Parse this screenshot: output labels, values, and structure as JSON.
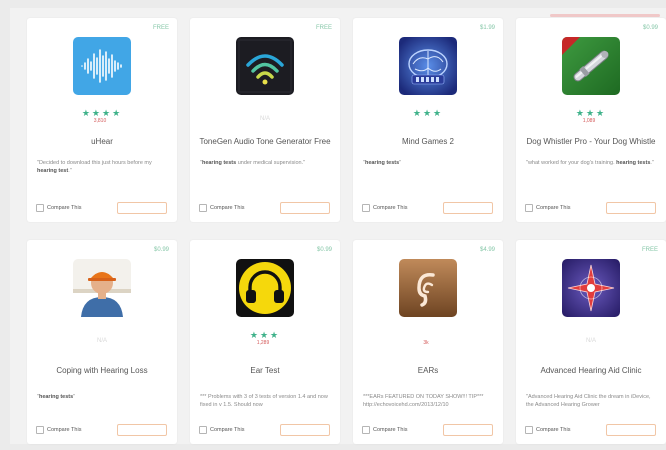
{
  "accent": {
    "price": "#86c7a8",
    "stars": "#3fb28a",
    "button": "#f2b48f"
  },
  "compare_label": "Compare This",
  "apps": [
    {
      "name": "uHear",
      "price": "FREE",
      "icon": "waveform-icon",
      "stars": 4,
      "count_a": "3,810",
      "count_b": "",
      "desc_pre": "\"Decided to download this just hours before my ",
      "desc_bold": "hearing test",
      "desc_post": ".\""
    },
    {
      "name": "ToneGen Audio Tone Generator Free",
      "price": "FREE",
      "icon": "signal-waves-icon",
      "stars": 0,
      "na": "N/A",
      "desc_pre": "\"",
      "desc_bold": "hearing tests",
      "desc_post": " under medical supervision.\""
    },
    {
      "name": "Mind Games 2",
      "price": "$1.99",
      "icon": "brain-icon",
      "stars": 3,
      "count_a": "",
      "count_b": "",
      "desc_pre": "\"",
      "desc_bold": "hearing tests",
      "desc_post": "\""
    },
    {
      "name": "Dog Whistler Pro - Your Dog Whistle",
      "price": "$0.99",
      "icon": "whistle-icon",
      "stars": 3,
      "count_a": "1,089",
      "count_b": "",
      "desc_pre": "\"what worked for your dog's training. ",
      "desc_bold": "hearing tests",
      "desc_post": ".\""
    },
    {
      "name": "Coping with Hearing Loss",
      "price": "$0.99",
      "icon": "person-photo-icon",
      "stars": 0,
      "na": "N/A",
      "desc_pre": "\"",
      "desc_bold": "hearing tests",
      "desc_post": "\""
    },
    {
      "name": "Ear Test",
      "price": "$0.99",
      "icon": "headphones-icon",
      "stars": 3,
      "count_a": "1,289",
      "count_b": "",
      "desc_pre": "*** Problems with 3 of 3 tests of version 1.4 and now fixed in v 1.5. Should now",
      "desc_bold": "",
      "desc_post": ""
    },
    {
      "name": "EARs",
      "price": "$4.99",
      "icon": "ear-icon",
      "stars": 0,
      "count_a": "3k",
      "count_b": "",
      "desc_pre": "***EARs FEATURED ON TODAY SHOW!!! TIP*** http://echovoicehd.com/2013/12/10",
      "desc_bold": "",
      "desc_post": ""
    },
    {
      "name": "Advanced Hearing Aid Clinic",
      "price": "FREE",
      "icon": "compass-star-icon",
      "stars": 0,
      "na": "N/A",
      "desc_pre": "\"Advanced Hearing Aid Clinic the dream in iDevice, the Advanced Hearing Grower",
      "desc_bold": "",
      "desc_post": ""
    }
  ]
}
